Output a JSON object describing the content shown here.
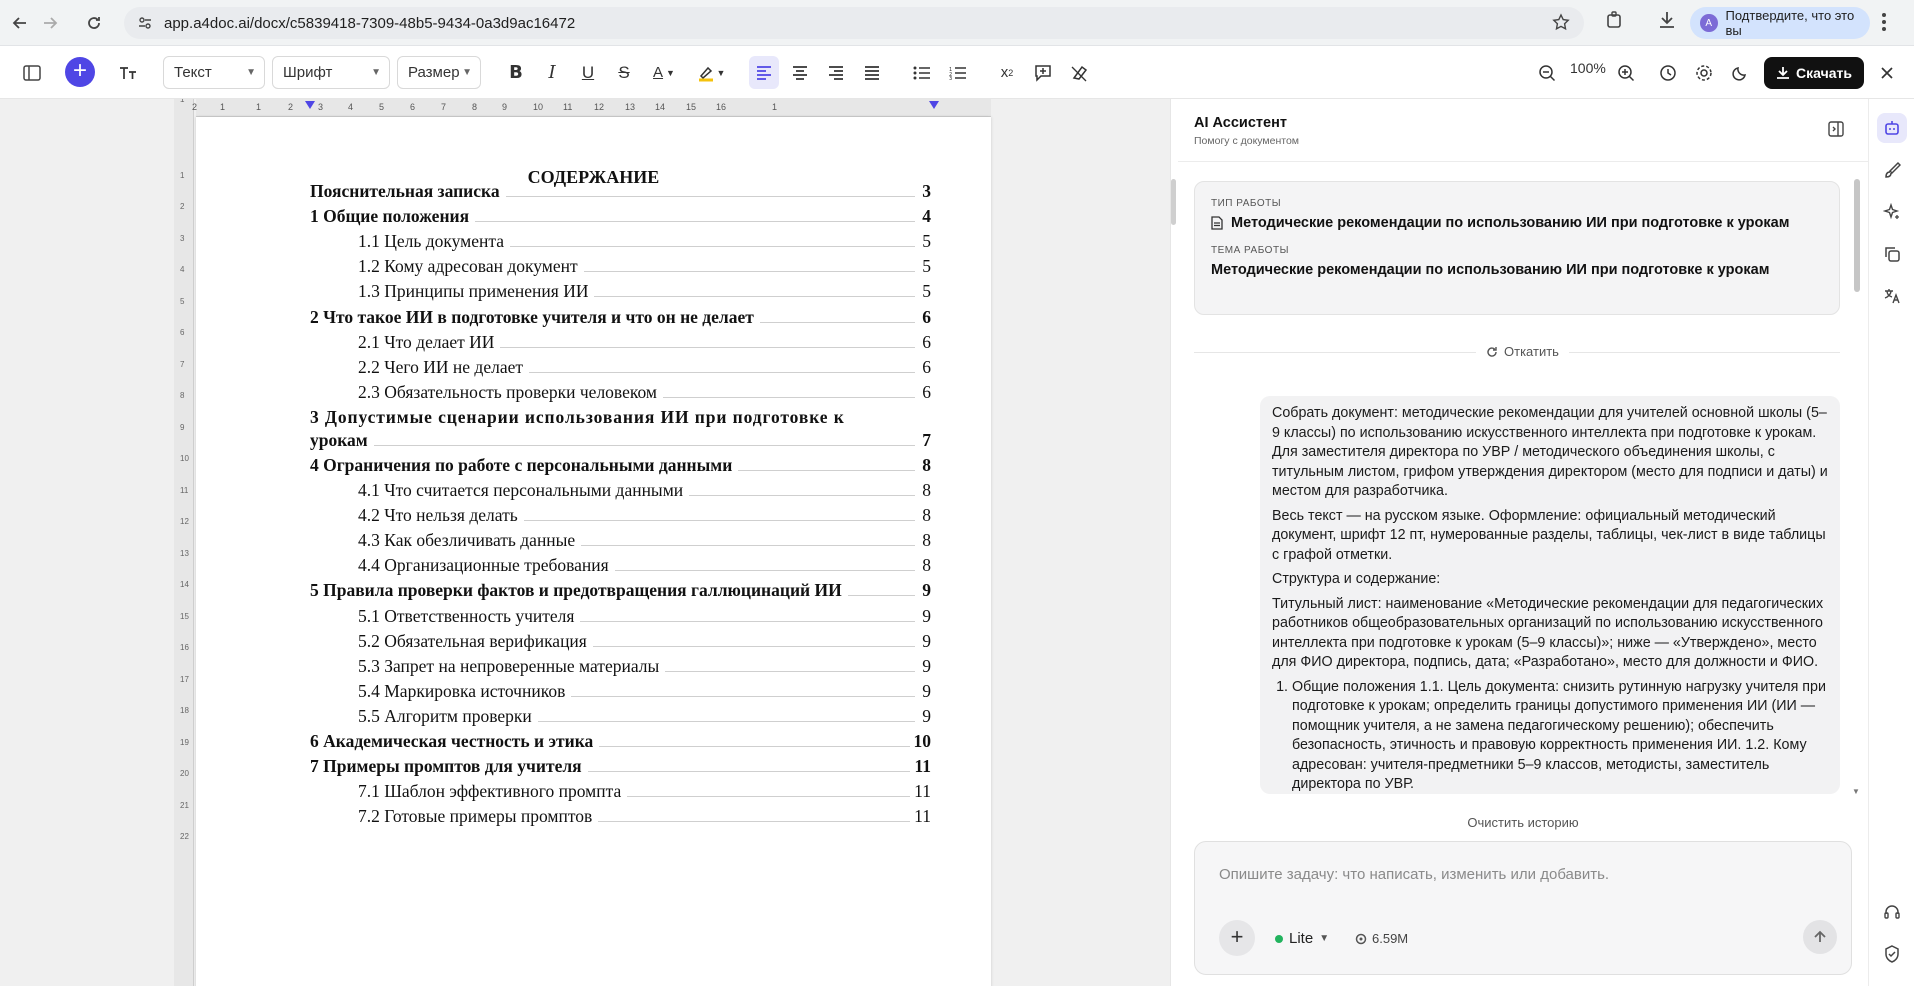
{
  "browser": {
    "url": "app.a4doc.ai/docx/c5839418-7309-48b5-9434-0a3d9ac16472",
    "verify_label": "Подтвердите, что это вы",
    "avatar_letter": "A"
  },
  "toolbar": {
    "style_select": "Текст",
    "font_select": "Шрифт",
    "size_select": "Размер",
    "zoom": "100%",
    "download_label": "Скачать",
    "accent": "#4f46e5"
  },
  "ruler": {
    "h_numbers": [
      "2",
      "1",
      "1",
      "2",
      "3",
      "4",
      "5",
      "6",
      "7",
      "8",
      "9",
      "10",
      "11",
      "12",
      "13",
      "14",
      "15",
      "16",
      "1"
    ],
    "v_numbers": [
      "1",
      "1",
      "2",
      "3",
      "4",
      "5",
      "6",
      "7",
      "8",
      "9",
      "10",
      "11",
      "12",
      "13",
      "14",
      "15",
      "16",
      "17",
      "18",
      "19",
      "20",
      "21",
      "22"
    ]
  },
  "document": {
    "title": "СОДЕРЖАНИЕ",
    "toc": [
      {
        "text": "Пояснительная записка",
        "page": "3",
        "level": 1
      },
      {
        "text": "1 Общие положения",
        "page": "4",
        "level": 1
      },
      {
        "text": "1.1 Цель документа",
        "page": "5",
        "level": 2
      },
      {
        "text": "1.2 Кому адресован документ",
        "page": "5",
        "level": 2
      },
      {
        "text": "1.3 Принципы применения ИИ",
        "page": "5",
        "level": 2
      },
      {
        "text": "2 Что такое ИИ в подготовке учителя и что он не делает",
        "page": "6",
        "level": 1
      },
      {
        "text": "2.1 Что делает ИИ",
        "page": "6",
        "level": 2
      },
      {
        "text": "2.2 Чего ИИ не делает",
        "page": "6",
        "level": 2
      },
      {
        "text": "2.3 Обязательность проверки человеком",
        "page": "6",
        "level": 2
      },
      {
        "text": "3 Допустимые сценарии использования ИИ при подготовке к",
        "page": "",
        "level": 1
      },
      {
        "text": "урокам",
        "page": "7",
        "level": 1
      },
      {
        "text": "4 Ограничения по работе с персональными данными",
        "page": "8",
        "level": 1
      },
      {
        "text": "4.1 Что считается персональными данными",
        "page": "8",
        "level": 2
      },
      {
        "text": "4.2 Что нельзя делать",
        "page": "8",
        "level": 2
      },
      {
        "text": "4.3 Как обезличивать данные",
        "page": "8",
        "level": 2
      },
      {
        "text": "4.4 Организационные требования",
        "page": "8",
        "level": 2
      },
      {
        "text": "5 Правила проверки фактов и предотвращения галлюцинаций ИИ",
        "page": "9",
        "level": 1
      },
      {
        "text": "5.1 Ответственность учителя",
        "page": "9",
        "level": 2
      },
      {
        "text": "5.2 Обязательная верификация",
        "page": "9",
        "level": 2
      },
      {
        "text": "5.3 Запрет на непроверенные материалы",
        "page": "9",
        "level": 2
      },
      {
        "text": "5.4 Маркировка источников",
        "page": "9",
        "level": 2
      },
      {
        "text": "5.5 Алгоритм проверки",
        "page": "9",
        "level": 2
      },
      {
        "text": "6 Академическая честность и этика",
        "page": "10",
        "level": 1
      },
      {
        "text": "7 Примеры промптов для учителя",
        "page": "11",
        "level": 1
      },
      {
        "text": "7.1 Шаблон эффективного промпта",
        "page": "11",
        "level": 2
      },
      {
        "text": "7.2 Готовые примеры промптов",
        "page": "11",
        "level": 2
      }
    ]
  },
  "assistant": {
    "title": "AI Ассистент",
    "subtitle": "Помогу с документом",
    "work_type_caption": "ТИП РАБОТЫ",
    "work_type_value": "Методические рекомендации по использованию ИИ при подготовке к урокам",
    "topic_caption": "ТЕМА РАБОТЫ",
    "topic_value": "Методические рекомендации по использованию ИИ при подготовке к урокам",
    "undo_label": "Откатить",
    "message_paragraphs": [
      "Собрать документ: методические рекомендации для учителей основной школы (5–9 классы) по использованию искусственного интеллекта при подготовке к урокам. Для заместителя директора по УВР / методического объединения школы, с титульным листом, грифом утверждения директором (место для подписи и даты) и местом для разработчика.",
      "Весь текст — на русском языке. Оформление: официальный методический документ, шрифт 12 пт, нумерованные разделы, таблицы, чек-лист в виде таблицы с графой отметки.",
      "Структура и содержание:",
      "Титульный лист: наименование «Методические рекомендации для педагогических работников общеобразовательных организаций по использованию искусственного интеллекта при подготовке к урокам (5–9 классы)»; ниже — «Утверждено», место для ФИО директора, подпись, дата; «Разработано», место для должности и ФИО."
    ],
    "message_list_item": "Общие положения 1.1. Цель документа: снизить рутинную нагрузку учителя при подготовке к урокам; определить границы допустимого применения ИИ (ИИ — помощник учителя, а не замена педагогическому решению); обеспечить безопасность, этичность и правовую корректность применения ИИ. 1.2. Кому адресован: учителя-предметники 5–9 классов, методисты, заместитель директора по УВР.",
    "clear_history": "Очистить историю",
    "input_placeholder": "Опишите задачу: что написать, изменить или добавить.",
    "model_label": "Lite",
    "tokens": "6.59M"
  }
}
